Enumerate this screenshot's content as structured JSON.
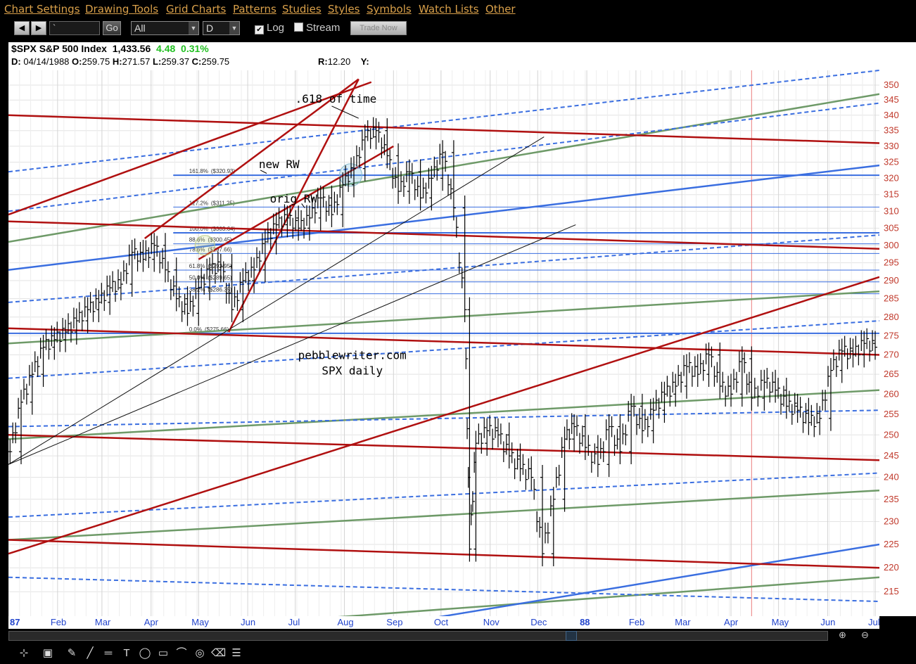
{
  "menu": [
    {
      "id": "chart-settings",
      "label": "Chart Settings"
    },
    {
      "id": "drawing-tools",
      "label": "Drawing Tools"
    },
    {
      "id": "grid-charts",
      "label": "Grid Charts"
    },
    {
      "id": "patterns",
      "label": "Patterns"
    },
    {
      "id": "studies",
      "label": "Studies"
    },
    {
      "id": "styles",
      "label": "Styles"
    },
    {
      "id": "symbols",
      "label": "Symbols"
    },
    {
      "id": "watch-lists",
      "label": "Watch Lists"
    },
    {
      "id": "other",
      "label": "Other"
    }
  ],
  "toolbar": {
    "prev_label": "◀",
    "next_label": "▶",
    "symbol_value": "`",
    "go_label": "Go",
    "range_value": "All",
    "period_value": "D",
    "log_label": "Log",
    "log_checked": true,
    "stream_label": "Stream",
    "stream_checked": false,
    "trade_now_label": "Trade Now"
  },
  "header": {
    "symbol": "$SPX",
    "name": "S&P 500 Index",
    "last": "1,433.56",
    "change": "4.48",
    "change_pct": "0.31%",
    "date_label": "D:",
    "date": "04/14/1988",
    "open_label": "O:",
    "open": "259.75",
    "high_label": "H:",
    "high": "271.57",
    "low_label": "L:",
    "low": "259.37",
    "close_label": "C:",
    "close": "259.75",
    "r_label": "R:",
    "r_value": "12.20",
    "y_label": "Y:"
  },
  "colors": {
    "red_line": "#b01010",
    "blue_line": "#3a6ee0",
    "green_line": "#6e9a68",
    "axis_text": "#c0392b",
    "month_text": "#2244cc",
    "up": "#22c022"
  },
  "chart_data": {
    "type": "line",
    "title": "",
    "xlabel": "",
    "ylabel": "",
    "scale": "log",
    "ylim": [
      210,
      355
    ],
    "grid": true,
    "y_ticks": [
      215,
      220,
      225,
      230,
      235,
      240,
      245,
      250,
      255,
      260,
      265,
      270,
      275,
      280,
      285,
      290,
      295,
      300,
      305,
      310,
      315,
      320,
      325,
      330,
      335,
      340,
      345,
      350
    ],
    "x_ticks": [
      "87",
      "Feb",
      "Mar",
      "Apr",
      "May",
      "Jun",
      "Jul",
      "Aug",
      "Sep",
      "Oct",
      "Nov",
      "Dec",
      "88",
      "Feb",
      "Mar",
      "Apr",
      "May",
      "Jun",
      "Jul"
    ],
    "series": [
      {
        "values": [
          {
            "date": "1987-01-02",
            "close": 246
          },
          {
            "date": "1987-01-09",
            "close": 258
          },
          {
            "date": "1987-01-16",
            "close": 265
          },
          {
            "date": "1987-01-23",
            "close": 272
          },
          {
            "date": "1987-01-30",
            "close": 274
          },
          {
            "date": "1987-02-06",
            "close": 276
          },
          {
            "date": "1987-02-13",
            "close": 279
          },
          {
            "date": "1987-02-20",
            "close": 282
          },
          {
            "date": "1987-02-27",
            "close": 284
          },
          {
            "date": "1987-03-06",
            "close": 288
          },
          {
            "date": "1987-03-13",
            "close": 289
          },
          {
            "date": "1987-03-20",
            "close": 298
          },
          {
            "date": "1987-03-27",
            "close": 296
          },
          {
            "date": "1987-04-03",
            "close": 300
          },
          {
            "date": "1987-04-10",
            "close": 293
          },
          {
            "date": "1987-04-17",
            "close": 285
          },
          {
            "date": "1987-04-24",
            "close": 281
          },
          {
            "date": "1987-05-01",
            "close": 288
          },
          {
            "date": "1987-05-08",
            "close": 293
          },
          {
            "date": "1987-05-15",
            "close": 294
          },
          {
            "date": "1987-05-22",
            "close": 282
          },
          {
            "date": "1987-05-29",
            "close": 290
          },
          {
            "date": "1987-06-05",
            "close": 293
          },
          {
            "date": "1987-06-12",
            "close": 301
          },
          {
            "date": "1987-06-19",
            "close": 306
          },
          {
            "date": "1987-06-26",
            "close": 308
          },
          {
            "date": "1987-07-03",
            "close": 305
          },
          {
            "date": "1987-07-10",
            "close": 308
          },
          {
            "date": "1987-07-17",
            "close": 314
          },
          {
            "date": "1987-07-24",
            "close": 309
          },
          {
            "date": "1987-07-31",
            "close": 318
          },
          {
            "date": "1987-08-07",
            "close": 323
          },
          {
            "date": "1987-08-14",
            "close": 333
          },
          {
            "date": "1987-08-21",
            "close": 335
          },
          {
            "date": "1987-08-28",
            "close": 327
          },
          {
            "date": "1987-09-04",
            "close": 316
          },
          {
            "date": "1987-09-11",
            "close": 322
          },
          {
            "date": "1987-09-18",
            "close": 314
          },
          {
            "date": "1987-09-25",
            "close": 320
          },
          {
            "date": "1987-10-02",
            "close": 328
          },
          {
            "date": "1987-10-09",
            "close": 311
          },
          {
            "date": "1987-10-16",
            "close": 282
          },
          {
            "date": "1987-10-19",
            "close": 224
          },
          {
            "date": "1987-10-23",
            "close": 248
          },
          {
            "date": "1987-10-30",
            "close": 251
          },
          {
            "date": "1987-11-06",
            "close": 250
          },
          {
            "date": "1987-11-13",
            "close": 245
          },
          {
            "date": "1987-11-20",
            "close": 242
          },
          {
            "date": "1987-11-27",
            "close": 240
          },
          {
            "date": "1987-12-04",
            "close": 223
          },
          {
            "date": "1987-12-11",
            "close": 235
          },
          {
            "date": "1987-12-18",
            "close": 249
          },
          {
            "date": "1987-12-24",
            "close": 252
          },
          {
            "date": "1987-12-31",
            "close": 247
          },
          {
            "date": "1988-01-08",
            "close": 243
          },
          {
            "date": "1988-01-15",
            "close": 252
          },
          {
            "date": "1988-01-22",
            "close": 246
          },
          {
            "date": "1988-01-29",
            "close": 257
          },
          {
            "date": "1988-02-05",
            "close": 251
          },
          {
            "date": "1988-02-12",
            "close": 256
          },
          {
            "date": "1988-02-19",
            "close": 260
          },
          {
            "date": "1988-02-26",
            "close": 262
          },
          {
            "date": "1988-03-04",
            "close": 267
          },
          {
            "date": "1988-03-11",
            "close": 265
          },
          {
            "date": "1988-03-18",
            "close": 270
          },
          {
            "date": "1988-03-25",
            "close": 262
          },
          {
            "date": "1988-04-01",
            "close": 260
          },
          {
            "date": "1988-04-08",
            "close": 269
          },
          {
            "date": "1988-04-14",
            "close": 259
          },
          {
            "date": "1988-04-22",
            "close": 263
          },
          {
            "date": "1988-04-29",
            "close": 261
          },
          {
            "date": "1988-05-06",
            "close": 257
          },
          {
            "date": "1988-05-13",
            "close": 256
          },
          {
            "date": "1988-05-20",
            "close": 253
          },
          {
            "date": "1988-05-27",
            "close": 254
          },
          {
            "date": "1988-06-03",
            "close": 266
          },
          {
            "date": "1988-06-10",
            "close": 271
          },
          {
            "date": "1988-06-17",
            "close": 270
          },
          {
            "date": "1988-06-24",
            "close": 273
          },
          {
            "date": "1988-07-01",
            "close": 272
          }
        ]
      }
    ],
    "fib_levels": [
      {
        "label": "161.8%",
        "price_label": "($320.93)",
        "value": 320.93
      },
      {
        "label": "127.2%",
        "price_label": "($311.25)",
        "value": 311.25
      },
      {
        "label": "100.0%",
        "price_label": "($303.64)",
        "value": 303.64
      },
      {
        "label": "88.6%",
        "price_label": "($300.45)",
        "value": 300.45
      },
      {
        "label": "78.6%",
        "price_label": "($297.66)",
        "value": 297.66
      },
      {
        "label": "61.8%",
        "price_label": "($292.95)",
        "value": 292.95
      },
      {
        "label": "50.0%",
        "price_label": "($289.65)",
        "value": 289.65
      },
      {
        "label": "38.2%",
        "price_label": "($286.35)",
        "value": 286.35
      },
      {
        "label": "0.0%",
        "price_label": "($275.66)",
        "value": 275.66
      }
    ],
    "annotations": [
      {
        "text": ".618 of time"
      },
      {
        "text": "new RW"
      },
      {
        "text": "orig RW"
      },
      {
        "text": "pebblewriter.com"
      },
      {
        "text": "SPX daily"
      }
    ]
  },
  "footer_tools": [
    {
      "name": "cursor-tool",
      "glyph": "⊹"
    },
    {
      "name": "select-tool",
      "glyph": "▣"
    },
    {
      "name": "pencil-tool",
      "glyph": "✎"
    },
    {
      "name": "line-tool",
      "glyph": "╱"
    },
    {
      "name": "hline-tool",
      "glyph": "═"
    },
    {
      "name": "text-tool",
      "glyph": "T"
    },
    {
      "name": "ellipse-tool",
      "glyph": "◯"
    },
    {
      "name": "rect-tool",
      "glyph": "▭"
    },
    {
      "name": "arc-tool",
      "glyph": "⌒"
    },
    {
      "name": "spiral-tool",
      "glyph": "◎"
    },
    {
      "name": "trash-tool",
      "glyph": "⌫"
    },
    {
      "name": "list-tool",
      "glyph": "☰"
    }
  ]
}
